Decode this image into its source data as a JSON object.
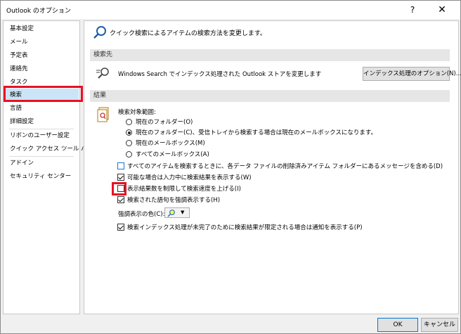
{
  "window": {
    "title": "Outlook のオプション",
    "help": "?",
    "close": "✕"
  },
  "sidebar": {
    "items": [
      "基本設定",
      "メール",
      "予定表",
      "連絡先",
      "タスク",
      "検索",
      "言語",
      "詳細設定",
      "リボンのユーザー設定",
      "クイック アクセス ツール バー",
      "アドイン",
      "セキュリティ センター"
    ],
    "active": "検索"
  },
  "main": {
    "header": "クイック検索によるアイテムの検索方法を変更します。",
    "sources": {
      "title": "検索先",
      "text": "Windows Search でインデックス処理された Outlook ストアを変更します",
      "index_button": "インデックス処理のオプション(N)..."
    },
    "results": {
      "title": "結果",
      "scope_label": "検索対象範囲:",
      "radios": [
        {
          "label": "現在のフォルダー(O)",
          "checked": false
        },
        {
          "label": "現在のフォルダー(C)、受信トレイから検索する場合は現在のメールボックスになります。",
          "checked": true
        },
        {
          "label": "現在のメールボックス(M)",
          "checked": false
        },
        {
          "label": "すべてのメールボックス(A)",
          "checked": false
        }
      ],
      "checks": [
        {
          "label": "すべてのアイテムを検索するときに、各データ ファイルの削除済みアイテム フォルダーにあるメッセージを含める(D)",
          "checked": false
        },
        {
          "label": "可能な場合は入力中に検索結果を表示する(W)",
          "checked": true
        },
        {
          "label": "表示結果数を制限して検索速度を上げる(I)",
          "checked": false
        },
        {
          "label": "検索された語句を強調表示する(H)",
          "checked": true
        }
      ],
      "color_label": "強調表示の色(C):",
      "last_check": {
        "label": "検索インデックス処理が未完了のために検索結果が限定される場合は通知を表示する(P)",
        "checked": true
      }
    }
  },
  "footer": {
    "ok": "OK",
    "cancel": "キャンセル"
  },
  "colors": {
    "highlight_red": "#e81123",
    "active_blue": "#cce4f7",
    "accent": "#0078d7"
  }
}
